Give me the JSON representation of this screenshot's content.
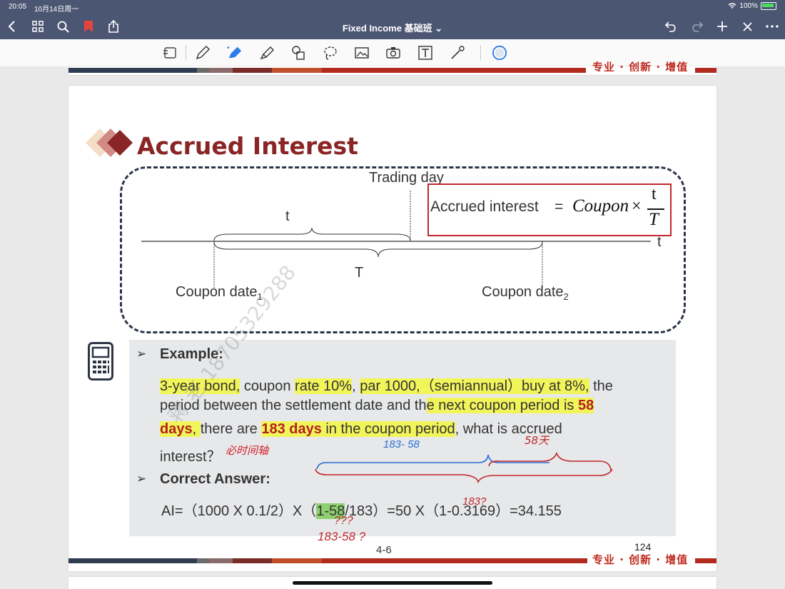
{
  "status": {
    "time": "20:05",
    "date": "10月14日周一",
    "battery": "100%"
  },
  "nav": {
    "doc_title": "Fixed Income 基础班",
    "title_chevron": "⌄"
  },
  "slide": {
    "title": "Accrued Interest",
    "diagram": {
      "trading_day": "Trading day",
      "t_label": "t",
      "t_axis": "t",
      "T_label": "T",
      "coupon1": "Coupon date",
      "coupon1_sub": "1",
      "coupon2": "Coupon date",
      "coupon2_sub": "2",
      "formula_left": "Accrued interest",
      "formula_eq": "=",
      "formula_coupon": "Coupon",
      "formula_times": "×",
      "formula_num": "t",
      "formula_den": "T"
    },
    "example": {
      "bullet": "➢",
      "heading": "Example:",
      "l1_a": "3-year bond,",
      "l1_b": " coupon ",
      "l1_c": "rate 10%",
      "l1_d": ", ",
      "l1_e": "par 1000,（semiannual）buy at 8%,",
      "l1_f": " the",
      "l2_a": "period  between the settlement date and th",
      "l2_b": "e next coupon period is ",
      "l2_c": "58",
      "l3_a": "days",
      "l3_b": ", ",
      "l3_c": " there are ",
      "l3_d": "183 days",
      "l3_e": " in the coupon period",
      "l3_f": ", what is accrued",
      "l4_a": "interest？"
    },
    "answer": {
      "bullet": "➢",
      "heading": "Correct Answer:",
      "a": "AI=（1000 X 0.1/2）X（",
      "b": "1-58",
      "c": "/183）=50 X（1-0.3169）=34.155"
    },
    "page_number": "124",
    "slide_number": "4-6",
    "brand": "专业 · 创新 · 增值"
  },
  "handwriting": {
    "note1": "必时间轴",
    "note2": "183- 58",
    "note3": "58天",
    "note4": "183-58 ?",
    "note5": "???",
    "note6": "183?"
  },
  "watermark": "蒋 老 18705329288",
  "colors": {
    "accent": "#c0281c",
    "title": "#8a2525",
    "highlight": "#f2f55a",
    "nav": "#4b5672"
  }
}
